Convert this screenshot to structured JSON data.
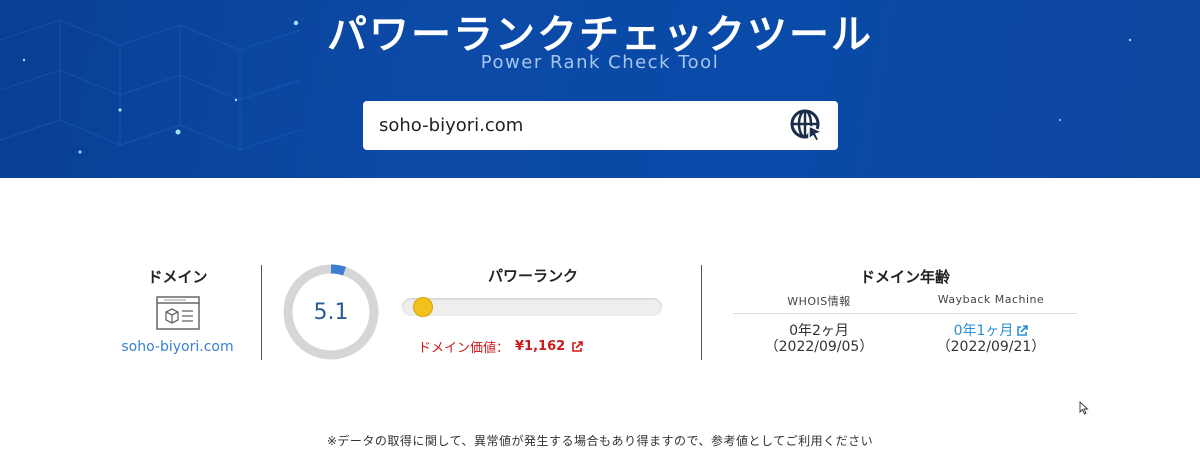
{
  "hero": {
    "title": "パワーランクチェックツール",
    "subtitle": "Power Rank Check Tool"
  },
  "search": {
    "value": "soho-biyori.com",
    "button_icon": "globe-cursor-icon"
  },
  "domain": {
    "title": "ドメイン",
    "icon": "webpage-icon",
    "value": "soho-biyori.com"
  },
  "power_rank": {
    "title": "パワーランク",
    "score": "5.1",
    "progress_fraction": 0.051,
    "value_label": "ドメイン価値：",
    "value_amount": "¥1,162",
    "value_icon": "external-link-icon"
  },
  "domain_age": {
    "title": "ドメイン年齢",
    "whois": {
      "label": "WHOIS情報",
      "age": "0年2ヶ月",
      "date": "（2022/09/05）"
    },
    "wayback": {
      "label": "Wayback Machine",
      "age": "0年1ヶ月",
      "date": "（2022/09/21）",
      "icon": "external-link-icon"
    }
  },
  "note": "※データの取得に関して、異常値が発生する場合もあり得ますので、参考値としてご利用ください",
  "colors": {
    "hero_bg": "#0b4aa6",
    "gauge_accent": "#3b7fd1",
    "price_red": "#cc1a1a",
    "link_blue": "#2a8fd0",
    "knob_yellow": "#f4c01c"
  }
}
